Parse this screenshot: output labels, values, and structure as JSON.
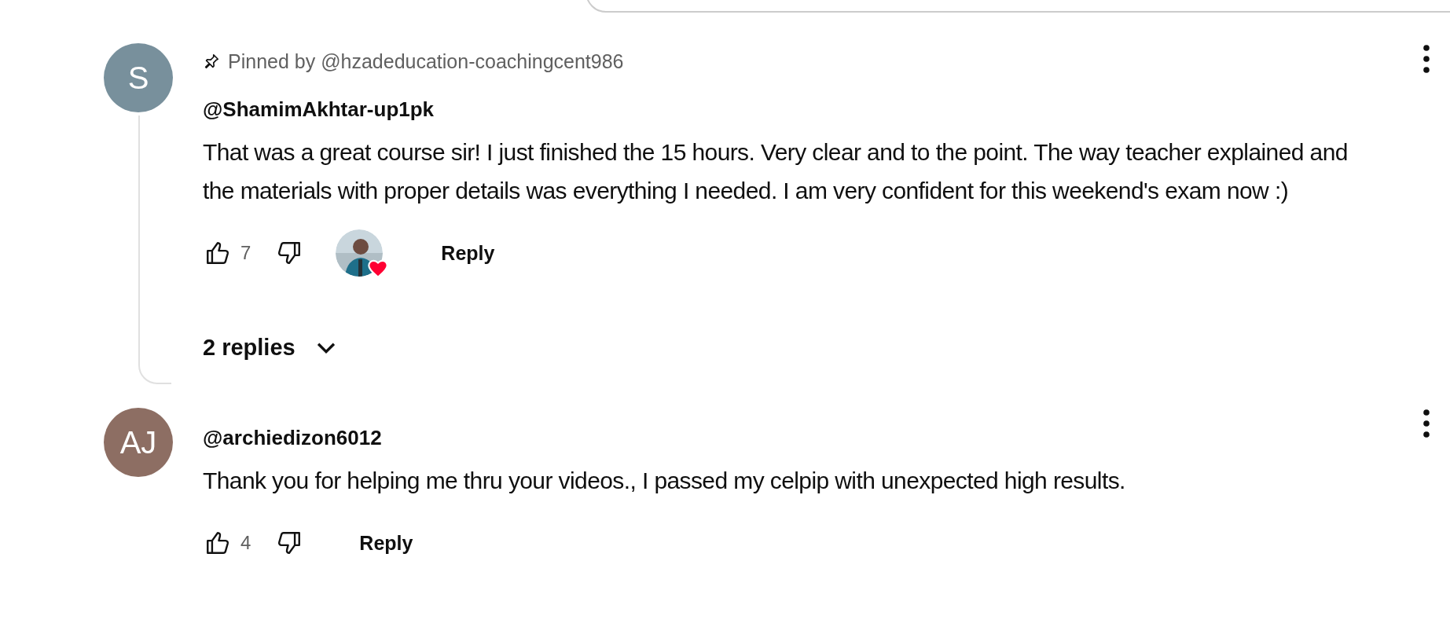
{
  "comments": [
    {
      "avatar_letter": "S",
      "color": "#78909c",
      "pinned": true,
      "pinned_by": "Pinned by @hzadeducation-coachingcent986",
      "author": "@ShamimAkhtar-up1pk",
      "text": "That was a great course sir! I just finished the 15 hours. Very clear and to the point. The way teacher explained and the materials with proper details was everything I needed. I am very confident for this weekend's exam now :)",
      "likes": "7",
      "hearted": true,
      "reply_label": "Reply",
      "replies": "2 replies"
    },
    {
      "avatar_letter": "AJ",
      "color": "#8d6e63",
      "pinned": false,
      "author": "@archiedizon6012",
      "text": "Thank you for helping me thru your videos., I passed my celpip with unexpected high results.",
      "likes": "4",
      "hearted": false,
      "reply_label": "Reply"
    }
  ]
}
